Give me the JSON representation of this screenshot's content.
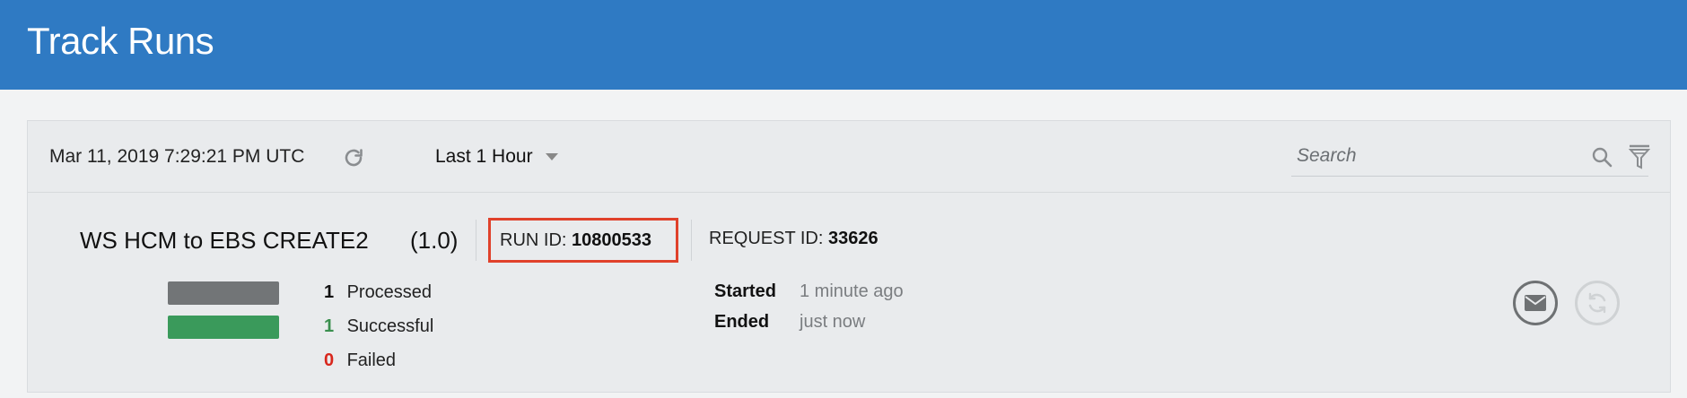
{
  "header": {
    "title": "Track Runs"
  },
  "toolbar": {
    "timestamp": "Mar 11, 2019 7:29:21 PM UTC",
    "refresh_icon": "refresh-icon",
    "time_range": "Last 1 Hour",
    "search_placeholder": "Search",
    "search_value": "",
    "search_icon": "search-icon",
    "filter_icon": "filter-icon"
  },
  "run": {
    "name": "WS HCM to EBS CREATE2",
    "version": "(1.0)",
    "run_id_label": "RUN ID:",
    "run_id": "10800533",
    "request_id_label": "REQUEST ID:",
    "request_id": "33626",
    "counts": {
      "processed": {
        "value": "1",
        "label": "Processed"
      },
      "successful": {
        "value": "1",
        "label": "Successful"
      },
      "failed": {
        "value": "0",
        "label": "Failed"
      }
    },
    "started_label": "Started",
    "started_value": "1 minute ago",
    "ended_label": "Ended",
    "ended_value": "just now",
    "actions": {
      "mail_icon": "mail-icon",
      "resubmit_icon": "resubmit-icon"
    }
  },
  "colors": {
    "header_bg": "#2f7ac3",
    "processed_bar": "#727577",
    "successful_bar": "#3a9a5b",
    "successful_text": "#3a8f4e",
    "failed_text": "#d8261c",
    "highlight_box": "#e0412b"
  }
}
